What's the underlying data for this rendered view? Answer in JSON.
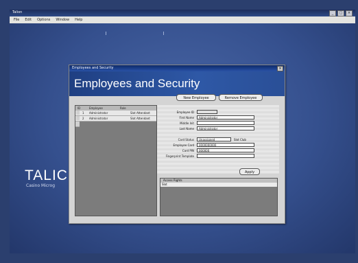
{
  "app": {
    "title": "Talion",
    "menu": [
      "File",
      "Edit",
      "Options",
      "Window",
      "Help"
    ],
    "window_controls": [
      "_",
      "□",
      "×"
    ]
  },
  "desktop": {
    "logo": "TALIC",
    "logo_sub": "Casino Microg"
  },
  "dialog": {
    "title": "Employees and Security",
    "close_label": "×",
    "banner_title": "Employees and Security",
    "buttons": {
      "new_employee": "New Employee",
      "remove_employee": "Remove Employee",
      "apply": "Apply"
    },
    "list": {
      "columns": [
        "ID",
        "Employee",
        "Role"
      ],
      "rows": [
        {
          "id": "1",
          "name": "Administrator",
          "role": "Slot Attendant"
        },
        {
          "id": "2",
          "name": "Administrator",
          "role": "Slot Attendant"
        }
      ]
    },
    "form": {
      "fields": [
        {
          "label": "Employee ID",
          "value": ""
        },
        {
          "label": "First Name",
          "value": "Administrator"
        },
        {
          "label": "Middle Init",
          "value": ""
        },
        {
          "label": "Last Name",
          "value": "Administrator"
        },
        {
          "label": "Card Status",
          "value": "Unassigned"
        },
        {
          "label": "Employee Card",
          "value": "0000000000"
        },
        {
          "label": "Card PIN",
          "value": "000000"
        },
        {
          "label": "Fingerprint Template",
          "value": ""
        }
      ],
      "card_status_extra": "Slot Club"
    },
    "access": {
      "header": "Access Rights",
      "first_row": "Slot"
    }
  }
}
